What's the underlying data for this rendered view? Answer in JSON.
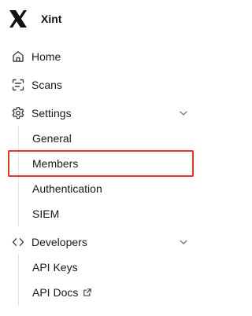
{
  "brand": {
    "name": "Xint",
    "logo_icon": "x-logo-icon"
  },
  "nav": {
    "home": {
      "label": "Home",
      "icon": "home-icon"
    },
    "scans": {
      "label": "Scans",
      "icon": "scan-icon"
    },
    "settings": {
      "label": "Settings",
      "icon": "gear-icon",
      "expanded": true,
      "children": [
        {
          "label": "General"
        },
        {
          "label": "Members",
          "highlighted": true
        },
        {
          "label": "Authentication"
        },
        {
          "label": "SIEM"
        }
      ]
    },
    "developers": {
      "label": "Developers",
      "icon": "code-icon",
      "expanded": true,
      "children": [
        {
          "label": "API Keys"
        },
        {
          "label": "API Docs",
          "external": true,
          "icon": "external-link-icon"
        }
      ]
    }
  },
  "colors": {
    "highlight": "#e5391e",
    "text": "#18181b",
    "muted": "#71717a",
    "divider": "#e4e4e7"
  }
}
